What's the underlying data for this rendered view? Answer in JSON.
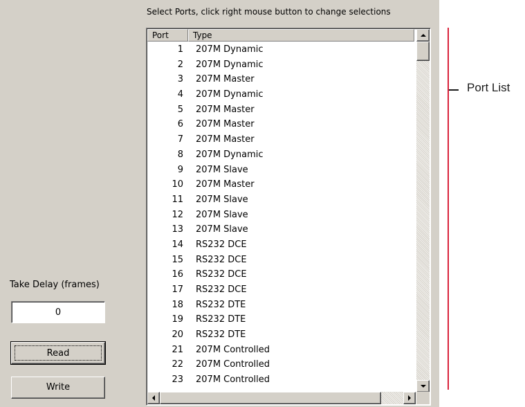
{
  "instructions": "Select Ports, click right mouse button to change selections",
  "port_list": {
    "columns": [
      "Port",
      "Type"
    ],
    "rows": [
      {
        "port": "1",
        "type": "207M Dynamic"
      },
      {
        "port": "2",
        "type": "207M Dynamic"
      },
      {
        "port": "3",
        "type": "207M Master"
      },
      {
        "port": "4",
        "type": "207M Dynamic"
      },
      {
        "port": "5",
        "type": "207M Master"
      },
      {
        "port": "6",
        "type": "207M Master"
      },
      {
        "port": "7",
        "type": "207M Master"
      },
      {
        "port": "8",
        "type": "207M Dynamic"
      },
      {
        "port": "9",
        "type": "207M Slave"
      },
      {
        "port": "10",
        "type": "207M Master"
      },
      {
        "port": "11",
        "type": "207M Slave"
      },
      {
        "port": "12",
        "type": "207M Slave"
      },
      {
        "port": "13",
        "type": "207M Slave"
      },
      {
        "port": "14",
        "type": "RS232 DCE"
      },
      {
        "port": "15",
        "type": "RS232 DCE"
      },
      {
        "port": "16",
        "type": "RS232 DCE"
      },
      {
        "port": "17",
        "type": "RS232 DCE"
      },
      {
        "port": "18",
        "type": "RS232 DTE"
      },
      {
        "port": "19",
        "type": "RS232 DTE"
      },
      {
        "port": "20",
        "type": "RS232 DTE"
      },
      {
        "port": "21",
        "type": "207M Controlled"
      },
      {
        "port": "22",
        "type": "207M Controlled"
      },
      {
        "port": "23",
        "type": "207M Controlled"
      }
    ]
  },
  "take_delay": {
    "label": "Take Delay (frames)",
    "value": "0"
  },
  "buttons": {
    "read": "Read",
    "write": "Write"
  },
  "annotation": {
    "label": "Port List",
    "line_color": "#d9213a"
  },
  "colors": {
    "panel_background": "#d4d0c8",
    "list_background": "#ffffff"
  },
  "icons": {
    "scroll_up": "arrow-up-icon",
    "scroll_down": "arrow-down-icon",
    "scroll_left": "arrow-left-icon",
    "scroll_right": "arrow-right-icon"
  }
}
